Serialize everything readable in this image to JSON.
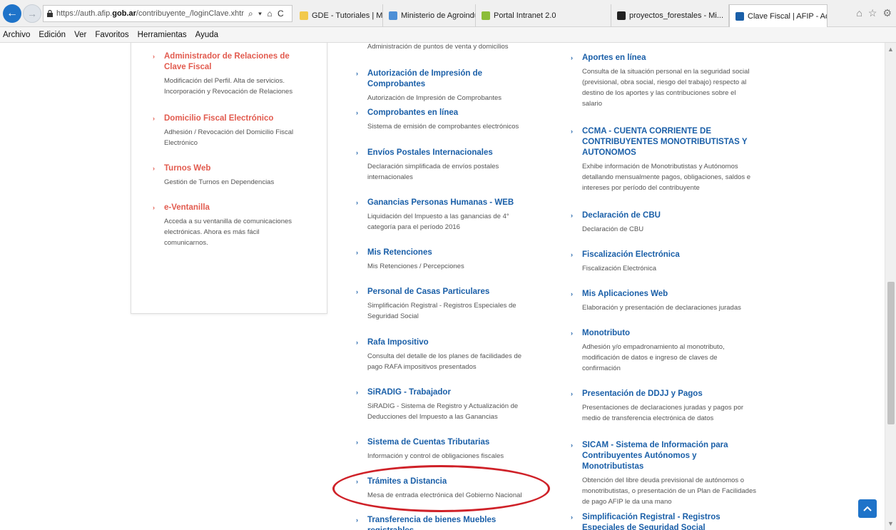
{
  "browser": {
    "url": "https://auth.afip.gob.ar/contribuyente_/loginClave.xhtr",
    "url_prefix": "https://auth.afip.",
    "url_domain": "gob.ar",
    "url_rest": "/contribuyente_/loginClave.xhtr",
    "address_actions": "⌕ ▾ ⌂ C",
    "tabs": [
      {
        "label": "GDE - Tutoriales | Ministe...",
        "icon_color": "#f2c94c",
        "active": false
      },
      {
        "label": "Ministerio de Agroindustria",
        "icon_color": "#4d8fd6",
        "active": false
      },
      {
        "label": "Portal Intranet 2.0",
        "icon_color": "#8bbd3a",
        "active": false
      },
      {
        "label": "proyectos_forestales - Mi...",
        "icon_color": "#222222",
        "active": false
      },
      {
        "label": "Clave Fiscal | AFIP - Ad...",
        "icon_color": "#1a5fa8",
        "active": true
      }
    ],
    "tab_close": "×"
  },
  "menu": [
    "Archivo",
    "Edición",
    "Ver",
    "Favoritos",
    "Herramientas",
    "Ayuda"
  ],
  "top_partial_text": "Administración de puntos de venta y domicilios",
  "left_column": [
    {
      "title": "Administrador de Relaciones de Clave Fiscal",
      "desc": "Modificación del Perfil. Alta de servicios. Incorporación y Revocación de Relaciones"
    },
    {
      "title": "Domicilio Fiscal Electrónico",
      "desc": "Adhesión / Revocación del Domicilio Fiscal Electrónico"
    },
    {
      "title": "Turnos Web",
      "desc": "Gestión de Turnos en Dependencias"
    },
    {
      "title": "e-Ventanilla",
      "desc": "Acceda a su ventanilla de comunicaciones electrónicas. Ahora es más fácil comunicarnos."
    }
  ],
  "middle_column": [
    {
      "title": "Autorización de Impresión de Comprobantes",
      "desc": "Autorización de Impresión de Comprobantes"
    },
    {
      "title": "Comprobantes en línea",
      "desc": "Sistema de emisión de comprobantes electrónicos"
    },
    {
      "title": "Envíos Postales Internacionales",
      "desc": "Declaración simplificada de envíos postales internacionales"
    },
    {
      "title": "Ganancias Personas Humanas - WEB",
      "desc": "Liquidación del Impuesto a las ganancias de 4° categoría para el período 2016"
    },
    {
      "title": "Mis Retenciones",
      "desc": "Mis Retenciones / Percepciones"
    },
    {
      "title": "Personal de Casas Particulares",
      "desc": "Simplificación Registral - Registros Especiales de Seguridad Social"
    },
    {
      "title": "Rafa Impositivo",
      "desc": "Consulta del detalle de los planes de facilidades de pago RAFA impositivos presentados"
    },
    {
      "title": "SiRADIG - Trabajador",
      "desc": "SiRADIG - Sistema de Registro y Actualización de Deducciones del Impuesto a las Ganancias"
    },
    {
      "title": "Sistema de Cuentas Tributarias",
      "desc": "Información y control de obligaciones fiscales"
    },
    {
      "title": "Trámites a Distancia",
      "desc": "Mesa de entrada electrónica del Gobierno Nacional"
    },
    {
      "title": "Transferencia de bienes Muebles registrables",
      "desc": ""
    }
  ],
  "right_column": [
    {
      "title": "Aportes en línea",
      "desc": "Consulta de la situación personal en la seguridad social (previsional, obra social, riesgo del trabajo) respecto al destino de los aportes y las contribuciones sobre el salario"
    },
    {
      "title": "CCMA - CUENTA CORRIENTE DE CONTRIBUYENTES MONOTRIBUTISTAS Y AUTONOMOS",
      "desc": "Exhibe información de Monotributistas y Autónomos detallando mensualmente pagos, obligaciones, saldos e intereses por período del contribuyente"
    },
    {
      "title": "Declaración de CBU",
      "desc": "Declaración de CBU"
    },
    {
      "title": "Fiscalización Electrónica",
      "desc": "Fiscalización Electrónica"
    },
    {
      "title": "Mis Aplicaciones Web",
      "desc": "Elaboración y presentación de declaraciones juradas"
    },
    {
      "title": "Monotributo",
      "desc": "Adhesión y/o empadronamiento al monotributo, modificación de datos e ingreso de claves de confirmación"
    },
    {
      "title": "Presentación de DDJJ y Pagos",
      "desc": "Presentaciones de declaraciones juradas y pagos por medio de transferencia electrónica de datos"
    },
    {
      "title": "SICAM - Sistema de Información para Contribuyentes Autónomos y Monotributistas",
      "desc": "Obtención del libre deuda previsional de autónomos o monotributistas, o presentación de un Plan de Facilidades de pago AFIP le da una mano"
    },
    {
      "title": "Simplificación Registral - Registros Especiales de Seguridad Social",
      "desc": ""
    }
  ],
  "colors": {
    "red_link": "#e25b4f",
    "blue_link": "#1a5fa8",
    "highlight": "#cf2128",
    "back_top": "#1e73c9"
  }
}
